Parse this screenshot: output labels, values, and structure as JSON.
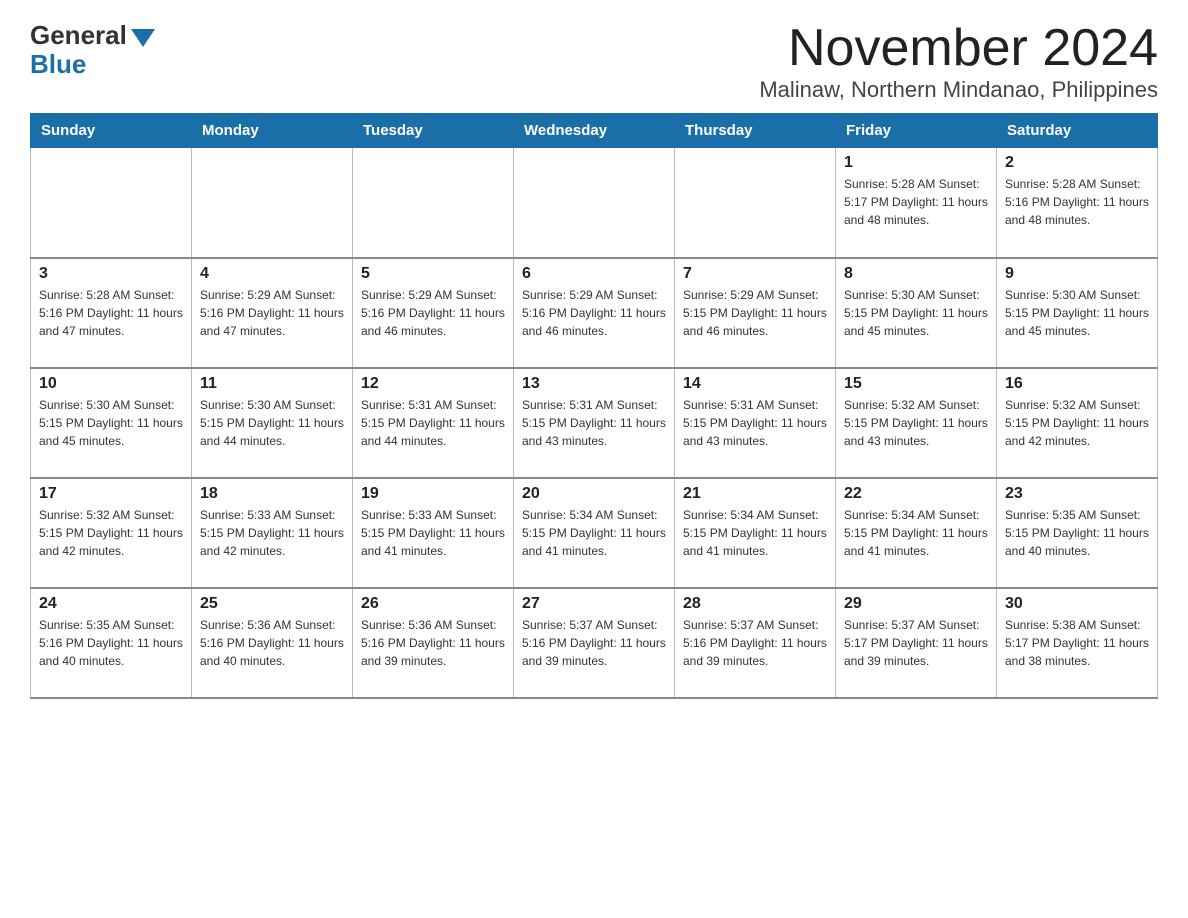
{
  "logo": {
    "general": "General",
    "blue": "Blue"
  },
  "header": {
    "title": "November 2024",
    "subtitle": "Malinaw, Northern Mindanao, Philippines"
  },
  "weekdays": [
    "Sunday",
    "Monday",
    "Tuesday",
    "Wednesday",
    "Thursday",
    "Friday",
    "Saturday"
  ],
  "weeks": [
    [
      {
        "day": "",
        "info": ""
      },
      {
        "day": "",
        "info": ""
      },
      {
        "day": "",
        "info": ""
      },
      {
        "day": "",
        "info": ""
      },
      {
        "day": "",
        "info": ""
      },
      {
        "day": "1",
        "info": "Sunrise: 5:28 AM\nSunset: 5:17 PM\nDaylight: 11 hours and 48 minutes."
      },
      {
        "day": "2",
        "info": "Sunrise: 5:28 AM\nSunset: 5:16 PM\nDaylight: 11 hours and 48 minutes."
      }
    ],
    [
      {
        "day": "3",
        "info": "Sunrise: 5:28 AM\nSunset: 5:16 PM\nDaylight: 11 hours and 47 minutes."
      },
      {
        "day": "4",
        "info": "Sunrise: 5:29 AM\nSunset: 5:16 PM\nDaylight: 11 hours and 47 minutes."
      },
      {
        "day": "5",
        "info": "Sunrise: 5:29 AM\nSunset: 5:16 PM\nDaylight: 11 hours and 46 minutes."
      },
      {
        "day": "6",
        "info": "Sunrise: 5:29 AM\nSunset: 5:16 PM\nDaylight: 11 hours and 46 minutes."
      },
      {
        "day": "7",
        "info": "Sunrise: 5:29 AM\nSunset: 5:15 PM\nDaylight: 11 hours and 46 minutes."
      },
      {
        "day": "8",
        "info": "Sunrise: 5:30 AM\nSunset: 5:15 PM\nDaylight: 11 hours and 45 minutes."
      },
      {
        "day": "9",
        "info": "Sunrise: 5:30 AM\nSunset: 5:15 PM\nDaylight: 11 hours and 45 minutes."
      }
    ],
    [
      {
        "day": "10",
        "info": "Sunrise: 5:30 AM\nSunset: 5:15 PM\nDaylight: 11 hours and 45 minutes."
      },
      {
        "day": "11",
        "info": "Sunrise: 5:30 AM\nSunset: 5:15 PM\nDaylight: 11 hours and 44 minutes."
      },
      {
        "day": "12",
        "info": "Sunrise: 5:31 AM\nSunset: 5:15 PM\nDaylight: 11 hours and 44 minutes."
      },
      {
        "day": "13",
        "info": "Sunrise: 5:31 AM\nSunset: 5:15 PM\nDaylight: 11 hours and 43 minutes."
      },
      {
        "day": "14",
        "info": "Sunrise: 5:31 AM\nSunset: 5:15 PM\nDaylight: 11 hours and 43 minutes."
      },
      {
        "day": "15",
        "info": "Sunrise: 5:32 AM\nSunset: 5:15 PM\nDaylight: 11 hours and 43 minutes."
      },
      {
        "day": "16",
        "info": "Sunrise: 5:32 AM\nSunset: 5:15 PM\nDaylight: 11 hours and 42 minutes."
      }
    ],
    [
      {
        "day": "17",
        "info": "Sunrise: 5:32 AM\nSunset: 5:15 PM\nDaylight: 11 hours and 42 minutes."
      },
      {
        "day": "18",
        "info": "Sunrise: 5:33 AM\nSunset: 5:15 PM\nDaylight: 11 hours and 42 minutes."
      },
      {
        "day": "19",
        "info": "Sunrise: 5:33 AM\nSunset: 5:15 PM\nDaylight: 11 hours and 41 minutes."
      },
      {
        "day": "20",
        "info": "Sunrise: 5:34 AM\nSunset: 5:15 PM\nDaylight: 11 hours and 41 minutes."
      },
      {
        "day": "21",
        "info": "Sunrise: 5:34 AM\nSunset: 5:15 PM\nDaylight: 11 hours and 41 minutes."
      },
      {
        "day": "22",
        "info": "Sunrise: 5:34 AM\nSunset: 5:15 PM\nDaylight: 11 hours and 41 minutes."
      },
      {
        "day": "23",
        "info": "Sunrise: 5:35 AM\nSunset: 5:15 PM\nDaylight: 11 hours and 40 minutes."
      }
    ],
    [
      {
        "day": "24",
        "info": "Sunrise: 5:35 AM\nSunset: 5:16 PM\nDaylight: 11 hours and 40 minutes."
      },
      {
        "day": "25",
        "info": "Sunrise: 5:36 AM\nSunset: 5:16 PM\nDaylight: 11 hours and 40 minutes."
      },
      {
        "day": "26",
        "info": "Sunrise: 5:36 AM\nSunset: 5:16 PM\nDaylight: 11 hours and 39 minutes."
      },
      {
        "day": "27",
        "info": "Sunrise: 5:37 AM\nSunset: 5:16 PM\nDaylight: 11 hours and 39 minutes."
      },
      {
        "day": "28",
        "info": "Sunrise: 5:37 AM\nSunset: 5:16 PM\nDaylight: 11 hours and 39 minutes."
      },
      {
        "day": "29",
        "info": "Sunrise: 5:37 AM\nSunset: 5:17 PM\nDaylight: 11 hours and 39 minutes."
      },
      {
        "day": "30",
        "info": "Sunrise: 5:38 AM\nSunset: 5:17 PM\nDaylight: 11 hours and 38 minutes."
      }
    ]
  ]
}
